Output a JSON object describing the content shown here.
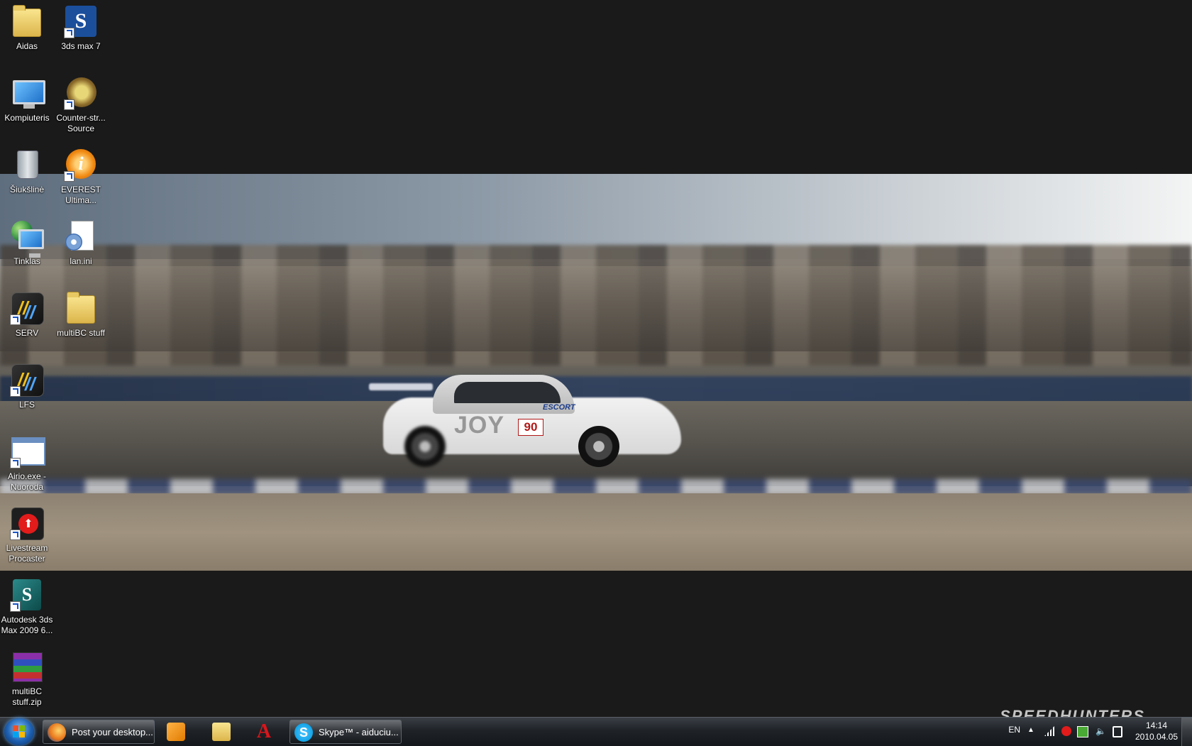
{
  "desktop": {
    "icons": [
      {
        "label": "Aidas",
        "icon": "user-folder-icon"
      },
      {
        "label": "3ds max 7",
        "icon": "3ds-max-icon"
      },
      {
        "label": "Kompiuteris",
        "icon": "computer-icon"
      },
      {
        "label": "Counter-str... Source",
        "icon": "counter-strike-icon"
      },
      {
        "label": "Šiukšlinė",
        "icon": "recycle-bin-icon"
      },
      {
        "label": "EVEREST Ultima...",
        "icon": "everest-info-icon"
      },
      {
        "label": "Tinklas",
        "icon": "network-icon"
      },
      {
        "label": "lan.ini",
        "icon": "config-file-icon"
      },
      {
        "label": "SERV",
        "icon": "lfs-icon"
      },
      {
        "label": "multiBC stuff",
        "icon": "folder-icon"
      },
      {
        "label": "LFS",
        "icon": "lfs-icon"
      },
      {
        "label": "Airio.exe - Nuoroda",
        "icon": "airio-icon"
      },
      {
        "label": "Livestream Procaster",
        "icon": "livestream-icon"
      },
      {
        "label": "Autodesk 3ds Max 2009 6...",
        "icon": "autodesk-3ds-max-icon"
      },
      {
        "label": "multiBC stuff.zip",
        "icon": "winrar-archive-icon"
      }
    ],
    "wallpaper": {
      "car_number": "90",
      "car_sponsor": "JOY",
      "car_decal": "ESCORT"
    },
    "watermark": "SPEEDHUNTERS"
  },
  "taskbar": {
    "start_icon": "windows-start-icon",
    "buttons": [
      {
        "label": "Post your desktop...",
        "icon": "firefox-icon",
        "color": "#e8761a"
      },
      {
        "label": "Skype™ - aiduciu...",
        "icon": "skype-icon",
        "color": "#12a5e8"
      }
    ],
    "pinned": [
      {
        "icon": "media-player-icon"
      },
      {
        "icon": "explorer-icon"
      },
      {
        "icon": "acrobat-icon"
      }
    ],
    "tray": {
      "language": "EN",
      "icons": [
        "show-hidden-icons-icon",
        "signal-icon",
        "skype-status-icon",
        "utorrent-icon",
        "volume-icon",
        "power-icon"
      ]
    },
    "clock": {
      "time": "14:14",
      "date": "2010.04.05"
    }
  }
}
